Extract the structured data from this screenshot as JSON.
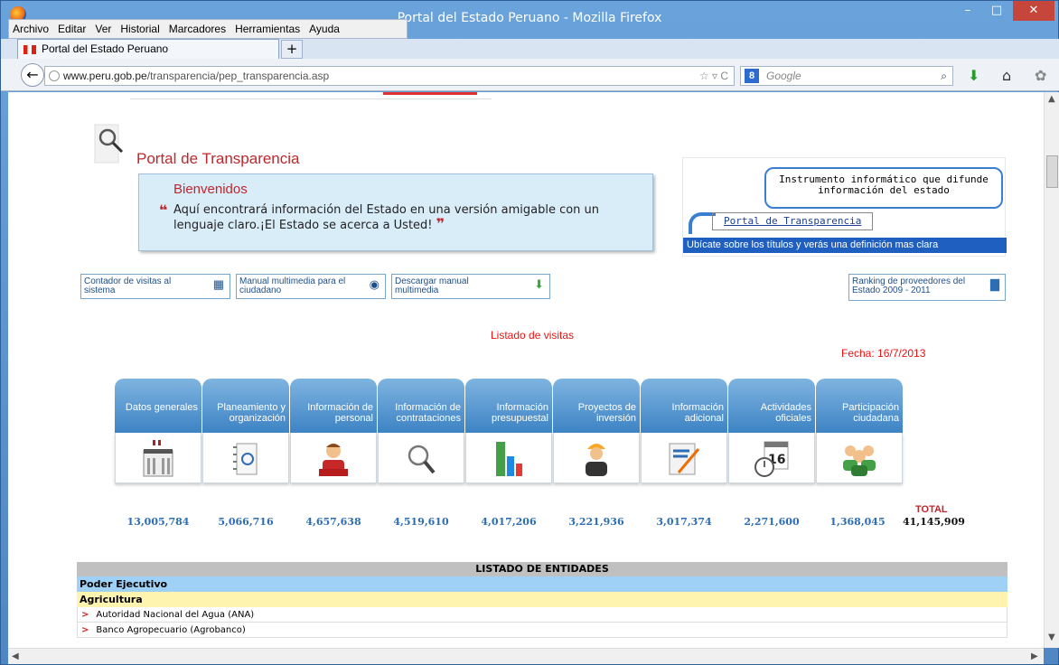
{
  "window": {
    "title": "Portal del Estado Peruano - Mozilla Firefox",
    "min": "–",
    "max": "□",
    "close": "✕"
  },
  "menu": [
    "Archivo",
    "Editar",
    "Ver",
    "Historial",
    "Marcadores",
    "Herramientas",
    "Ayuda"
  ],
  "tab": {
    "label": "Portal del Estado Peruano",
    "new_tab": "+"
  },
  "nav": {
    "url_host": "www.peru.gob.pe",
    "url_path": "/transparencia/pep_transparencia.asp",
    "search_placeholder": "Google",
    "back": "←",
    "url_icons": "☆ ▿ C",
    "search_engine_badge": "8",
    "search_glyph": "⌕",
    "download_glyph": "⬇",
    "home_glyph": "⌂",
    "addon_glyph": "✿"
  },
  "page": {
    "title": "Portal de Transparencia",
    "welcome_heading": "Bienvenidos",
    "welcome_text": "Aquí encontrará información del Estado en una versión amigable con un lenguaje claro.¡El Estado se acerca a Usted!",
    "open_quote": "❝",
    "close_quote": "❞",
    "bubble": "Instrumento informático que difunde información del estado",
    "portal_link": "Portal de Transparencia",
    "hint": "Ubícate sobre los títulos y verás una definición mas clara",
    "btn_visits": "Contador de visitas al sistema",
    "btn_manual": "Manual multimedia para el ciudadano",
    "btn_download": "Descargar manual multimedia",
    "btn_ranking": "Ranking de proveedores del Estado 2009 - 2011",
    "visits_title": "Listado de visitas",
    "fecha": "Fecha: 16/7/2013",
    "total_label": "TOTAL",
    "total_value": "41,145,909"
  },
  "categories": [
    {
      "label": "Datos generales",
      "count": "13,005,784",
      "icon": "building-icon"
    },
    {
      "label": "Planeamiento y organización",
      "count": "5,066,716",
      "icon": "notebook-icon"
    },
    {
      "label": "Información de personal",
      "count": "4,657,638",
      "icon": "person-icon"
    },
    {
      "label": "Información de contrataciones",
      "count": "4,519,610",
      "icon": "magnifier-icon"
    },
    {
      "label": "Información presupuestal",
      "count": "4,017,206",
      "icon": "bar-chart-icon"
    },
    {
      "label": "Proyectos de inversión",
      "count": "3,221,936",
      "icon": "worker-icon"
    },
    {
      "label": "Información adicional",
      "count": "3,017,374",
      "icon": "document-pencil-icon"
    },
    {
      "label": "Actividades oficiales",
      "count": "2,271,600",
      "icon": "calendar-clock-icon"
    },
    {
      "label": "Participación ciudadana",
      "count": "1,368,045",
      "icon": "people-icon"
    }
  ],
  "table": {
    "header": "LISTADO DE ENTIDADES",
    "group": "Poder Ejecutivo",
    "subgroup": "Agricultura",
    "row_marker": ">",
    "rows": [
      "Autoridad Nacional del Agua (ANA)",
      "Banco Agropecuario (Agrobanco)"
    ]
  },
  "colors": {
    "accent_red": "#c0272d",
    "link_blue": "#2c6db3",
    "firefox_frame": "#5b8fc7"
  }
}
